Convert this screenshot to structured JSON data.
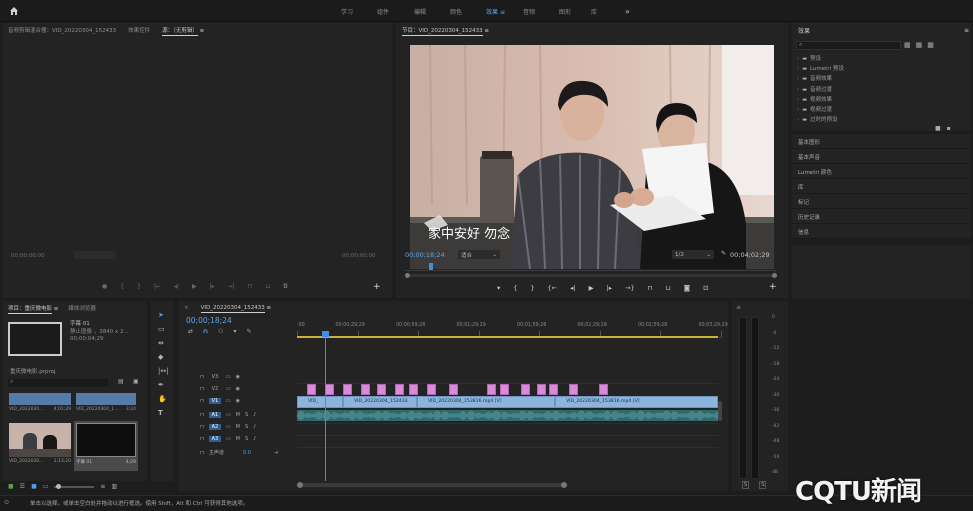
{
  "workspace_tabs": [
    "学习",
    "组件",
    "编辑",
    "颜色",
    "效果",
    "音频",
    "图形",
    "库"
  ],
  "active_workspace": "效果",
  "source_panel": {
    "tabs": [
      "音频剪辑混合器：VID_20220304_152433",
      "效果控件",
      "源：（无剪辑）"
    ],
    "timecode_left": "00;00;00;00",
    "timecode_right": "00;00;00;00"
  },
  "program_panel": {
    "tab": "节目：VID_20220304_152433",
    "subtitle": "家中安好  勿念",
    "timecode_current": "00;00;18;24",
    "fit": "适合",
    "resolution": "1/2",
    "timecode_duration": "00;04;02;29",
    "video_frame": "photo: two young men at a table, one holding papers, thermos on the left, curtain background"
  },
  "project_panel": {
    "tabs": [
      "项目：重庆微电影",
      "媒体浏览器"
    ],
    "clip_name": "字幕 01",
    "clip_info": "静止图像 ，3840 x 2...",
    "clip_duration": "00;00;04;29",
    "project_file": "重庆微电影.prproj",
    "thumbnails": [
      {
        "label": "VID_2022030...",
        "duration": "4;01;29"
      },
      {
        "label": "VID_20220304_1...",
        "duration": "3;24"
      },
      {
        "label": "VID_2022030...",
        "duration": "1;13;20"
      },
      {
        "label": "字幕 01",
        "duration": "4;29"
      }
    ]
  },
  "timeline": {
    "tab": "VID_20220304_152433",
    "timecode": "00;00;18;24",
    "ruler": [
      ":00",
      "00;00;29;29",
      "00;00;59;28",
      "00;01;29;29",
      "00;01;59;28",
      "00;02;29;29",
      "00;02;59;28",
      "00;03;29;29"
    ],
    "video_tracks": [
      "V3",
      "V2",
      "V1"
    ],
    "audio_tracks": [
      "A1",
      "A2",
      "A3"
    ],
    "master_label": "主声道",
    "master_value": "0.0",
    "clips": [
      "VID_",
      "VID_20220304_152433",
      "VID_20220304_153816.mp4 [V]",
      "VID_20220304_153816.mp4 [V]"
    ]
  },
  "effects_panel": {
    "title": "效果",
    "tree": [
      "预设",
      "Lumetri 预设",
      "音频效果",
      "音频过渡",
      "视频效果",
      "视频过渡",
      "过时的预设"
    ],
    "sections": [
      "基本图形",
      "基本声音",
      "Lumetri 颜色",
      "库",
      "标记",
      "历史记录",
      "信息"
    ]
  },
  "audio_meter_labels": [
    "0",
    "-6",
    "-12",
    "-18",
    "-24",
    "-30",
    "-36",
    "-42",
    "-48",
    "-54",
    "dB"
  ],
  "meter_buttons": [
    "S",
    "S"
  ],
  "status_bar": "单击以选择，或单击空白处并拖动以进行框选。使用 Shift，Alt 和 Ctrl 可获得其他选项。",
  "watermark": "CQTU新闻",
  "colors": {
    "accent": "#3f8fd8",
    "clip_video": "#8cb4dc",
    "clip_pink": "#d98ad9",
    "playhead": "#3d8fe0"
  }
}
